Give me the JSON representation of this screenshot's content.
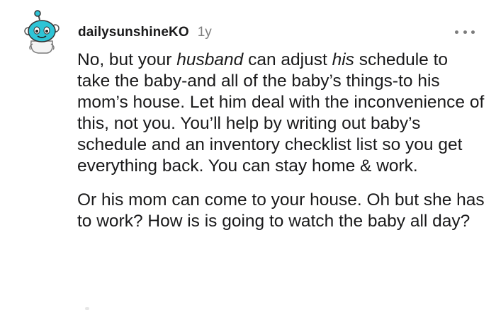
{
  "comment": {
    "username": "dailysunshineKO",
    "age": "1y",
    "avatar_icon": "snoo-avatar-icon",
    "more_icon": "more-options-icon",
    "paragraph1": {
      "t1": "No, but your ",
      "em1": "husband",
      "t2": " can adjust ",
      "em2": "his",
      "t3": " schedule to take the baby-and all of the baby’s things-to his mom’s house. Let him deal with the inconvenience of this, not you. You’ll help by writing out baby’s schedule and an inventory checklist list so you get everything back. You can stay home & work."
    },
    "paragraph2": "Or his mom can come to your house. Oh but she has to work? How is is going to watch the baby all day?"
  },
  "colors": {
    "text": "#1a1a1b",
    "meta": "#7c7c7c",
    "avatar_accent": "#2ec4d6"
  }
}
